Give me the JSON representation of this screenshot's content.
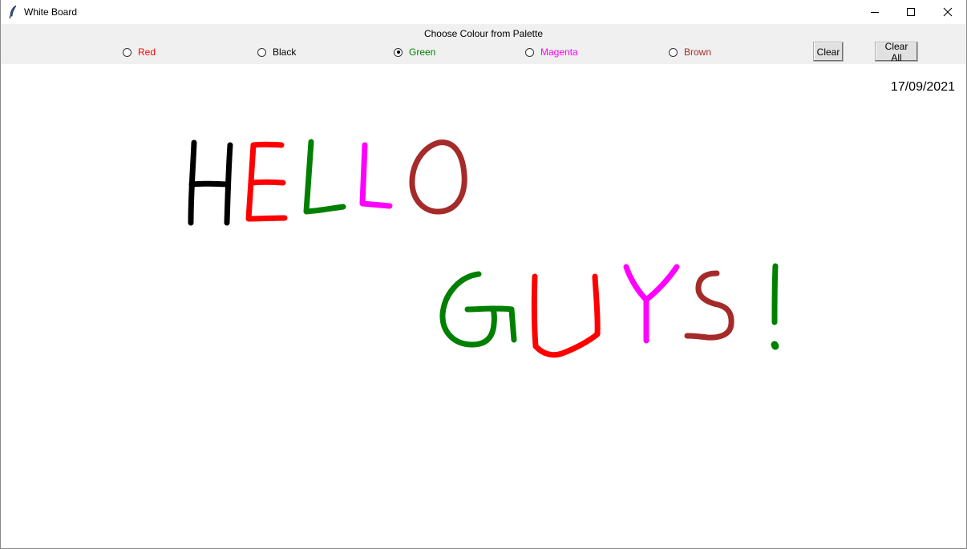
{
  "window": {
    "title": "White Board"
  },
  "palette": {
    "title": "Choose Colour from Palette",
    "options": [
      {
        "label": "Red",
        "color": "#ff0000",
        "checked": false
      },
      {
        "label": "Black",
        "color": "#000000",
        "checked": false
      },
      {
        "label": "Green",
        "color": "#008000",
        "checked": true
      },
      {
        "label": "Magenta",
        "color": "#ff00ff",
        "checked": false
      },
      {
        "label": "Brown",
        "color": "#a52a2a",
        "checked": false
      }
    ],
    "selected": "Green"
  },
  "toolbar": {
    "clear_label": "Clear",
    "clear_all_label": "Clear All"
  },
  "canvas": {
    "date": "17/09/2021",
    "strokes": [
      {
        "name": "letter-h",
        "color": "#000000"
      },
      {
        "name": "letter-e",
        "color": "#ff0000"
      },
      {
        "name": "letter-l1",
        "color": "#008000"
      },
      {
        "name": "letter-l2",
        "color": "#ff00ff"
      },
      {
        "name": "letter-o",
        "color": "#a52a2a"
      },
      {
        "name": "letter-g",
        "color": "#008000"
      },
      {
        "name": "letter-u",
        "color": "#ff0000"
      },
      {
        "name": "letter-y",
        "color": "#ff00ff"
      },
      {
        "name": "letter-s",
        "color": "#a52a2a"
      },
      {
        "name": "exclamation",
        "color": "#008000"
      }
    ]
  },
  "icons": {
    "app": "feather-icon",
    "minimize": "minimize-icon",
    "maximize": "maximize-icon",
    "close": "close-icon"
  }
}
